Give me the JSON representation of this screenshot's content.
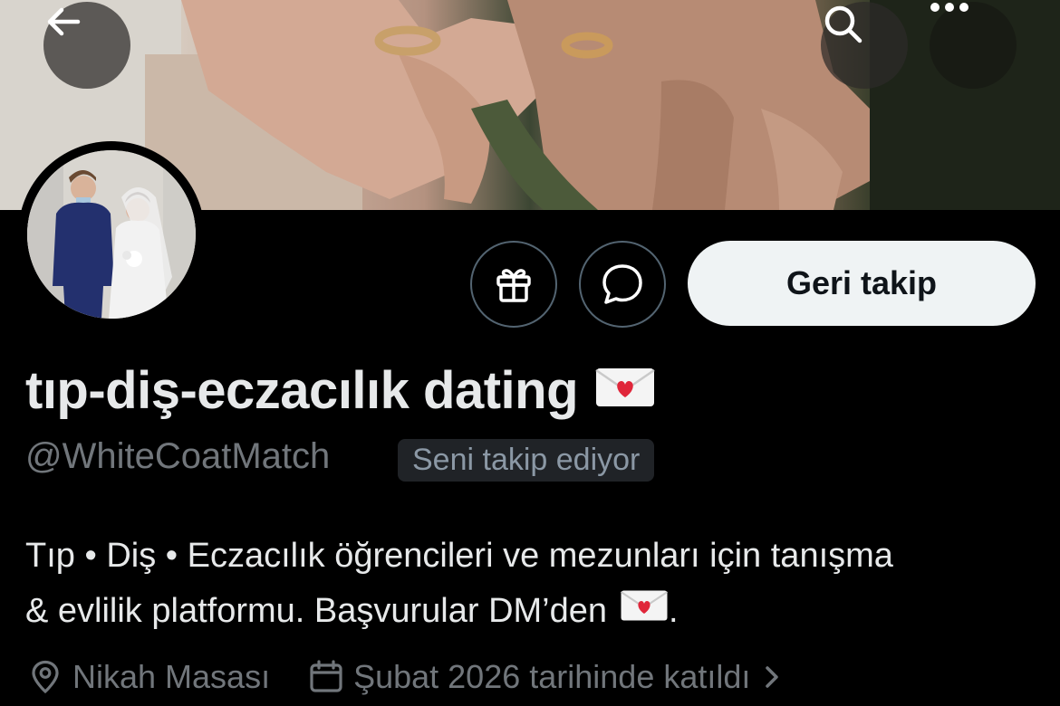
{
  "header": {
    "back_icon": "arrow-left-icon",
    "search_icon": "search-icon",
    "more_icon": "more-horizontal-icon"
  },
  "profile": {
    "display_name": "tıp-diş-eczacılık dating",
    "name_emoji": "love-letter-icon",
    "handle": "@WhiteCoatMatch",
    "follows_you": "Seni takip ediyor",
    "bio_line1": "Tıp • Diş • Eczacılık öğrencileri ve mezunları için tanışma",
    "bio_line2": "& evlilik platformu. Başvurular DM’den",
    "bio_line2_end": ".",
    "location": "Nikah Masası",
    "joined": "Şubat 2026 tarihinde katıldı"
  },
  "actions": {
    "gift_icon": "gift-icon",
    "message_icon": "message-bubble-icon",
    "follow_back_label": "Geri takip"
  },
  "colors": {
    "background": "#000000",
    "primary_text": "#e7e9ea",
    "secondary_text": "#71767b",
    "button_bg": "#eff3f4",
    "button_text": "#0f1419",
    "border": "#536471"
  }
}
